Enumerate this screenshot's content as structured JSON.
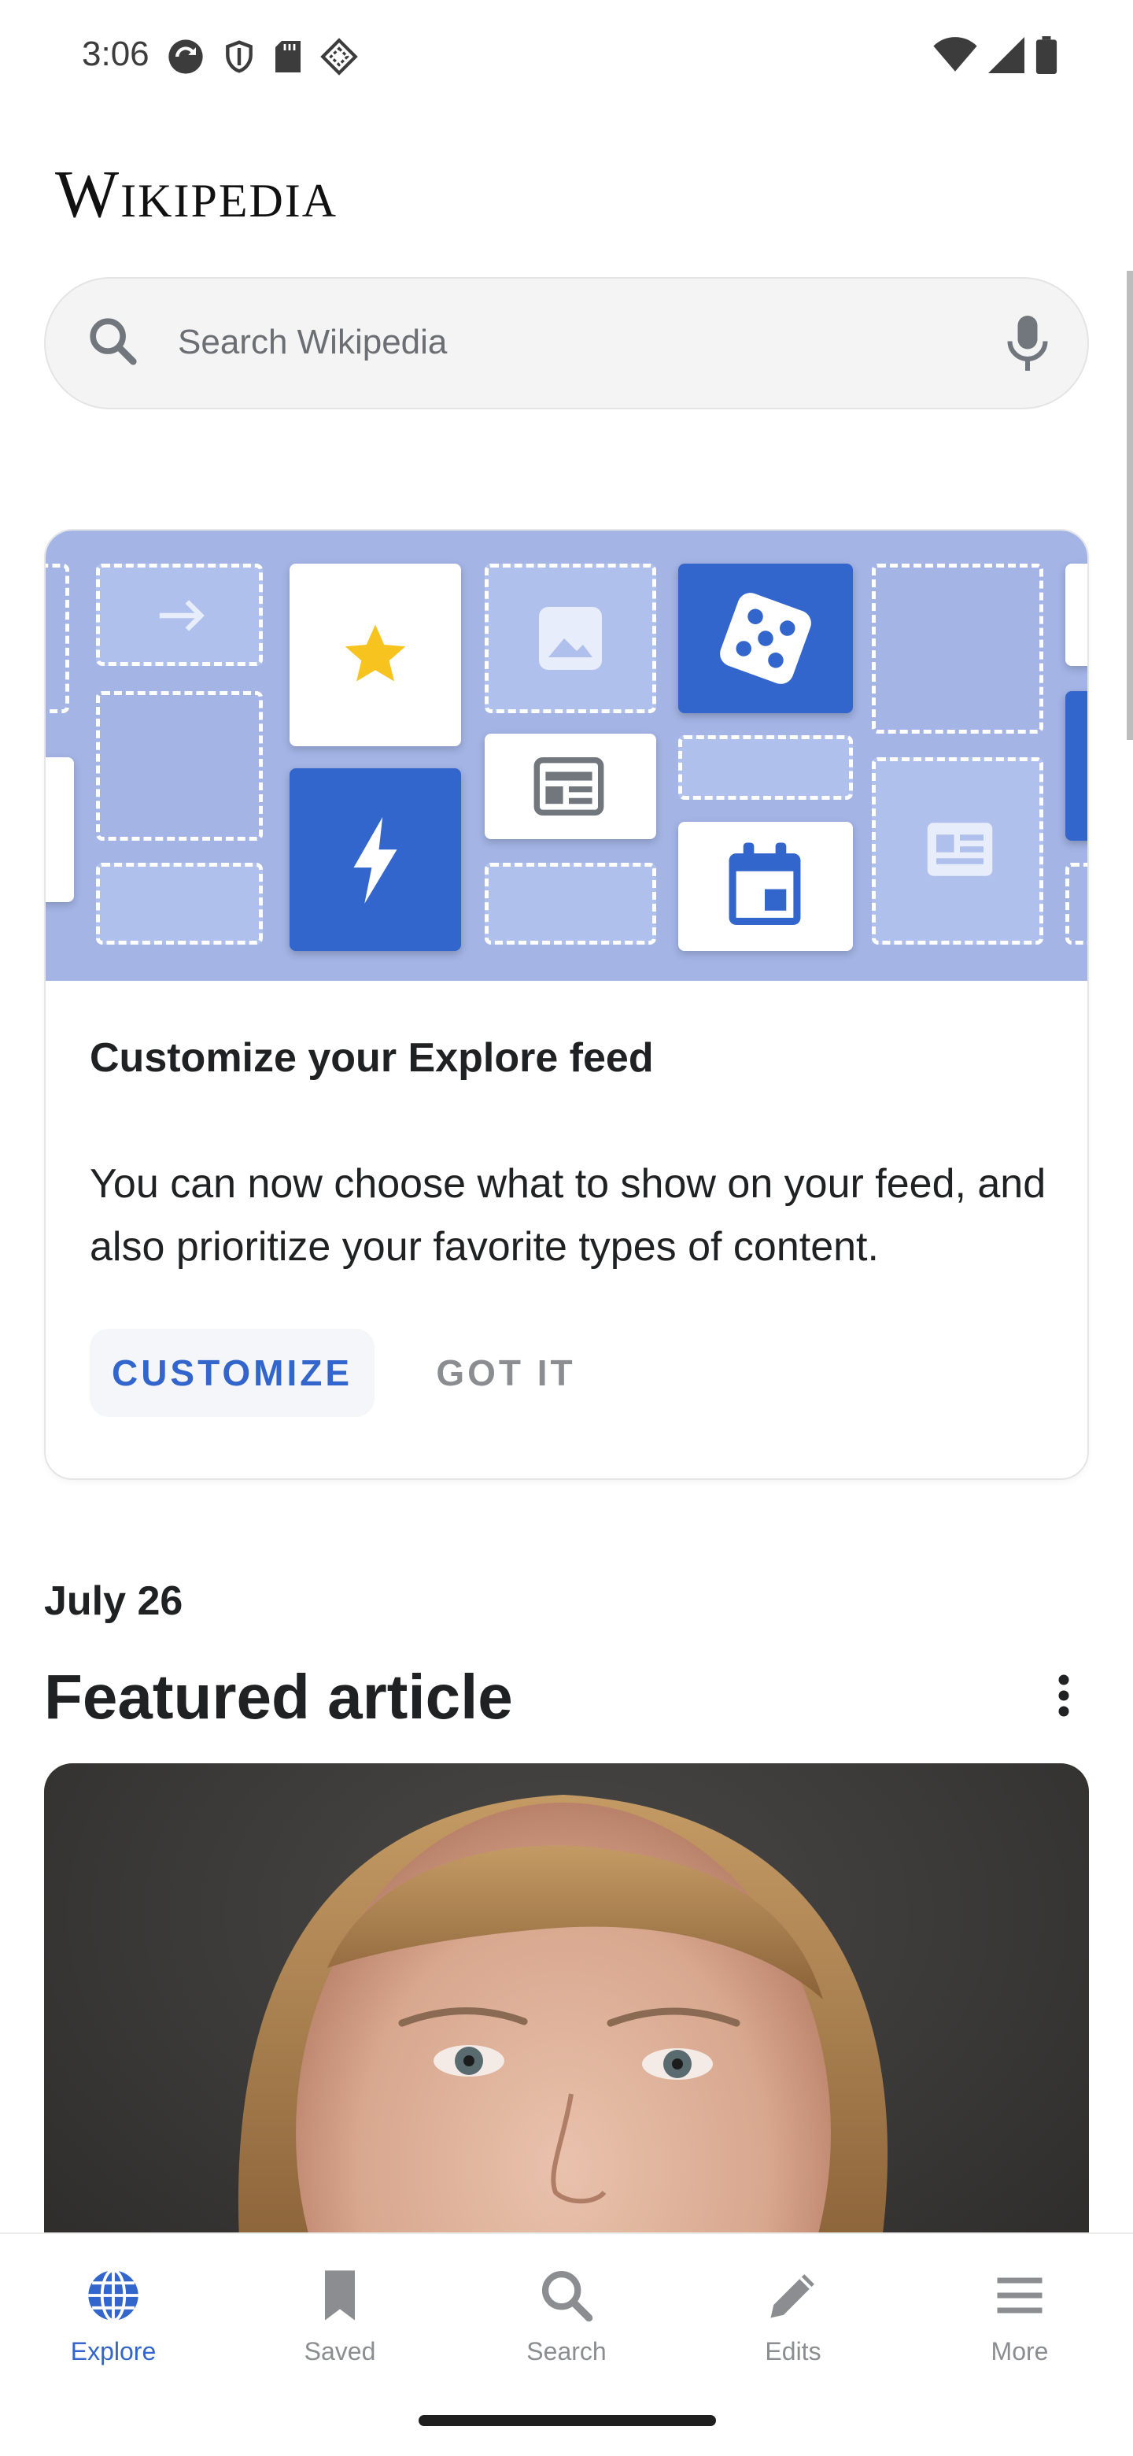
{
  "status_bar": {
    "time": "3:06",
    "left_icons": [
      "sync-icon",
      "shield-icon",
      "sd-card-icon",
      "nfc-diamond-icon"
    ],
    "right_icons": [
      "wifi-icon",
      "cellular-signal-icon",
      "battery-icon"
    ]
  },
  "header": {
    "wordmark": "Wikipedia"
  },
  "search": {
    "placeholder": "Search Wikipedia"
  },
  "customize_card": {
    "title": "Customize your Explore feed",
    "body": "You can now choose what to show on your feed, and also prioritize your favorite types of content.",
    "primary_button": "CUSTOMIZE",
    "secondary_button": "GOT IT"
  },
  "feed": {
    "date": "July 26",
    "section_title": "Featured article"
  },
  "bottom_nav": {
    "items": [
      {
        "label": "Explore",
        "icon": "globe-icon",
        "active": true
      },
      {
        "label": "Saved",
        "icon": "bookmark-icon",
        "active": false
      },
      {
        "label": "Search",
        "icon": "search-icon",
        "active": false
      },
      {
        "label": "Edits",
        "icon": "pencil-icon",
        "active": false
      },
      {
        "label": "More",
        "icon": "menu-icon",
        "active": false
      }
    ]
  },
  "colors": {
    "accent": "#3366cc",
    "illustration_bg": "#a3b4e5",
    "star": "#f7c31e"
  }
}
